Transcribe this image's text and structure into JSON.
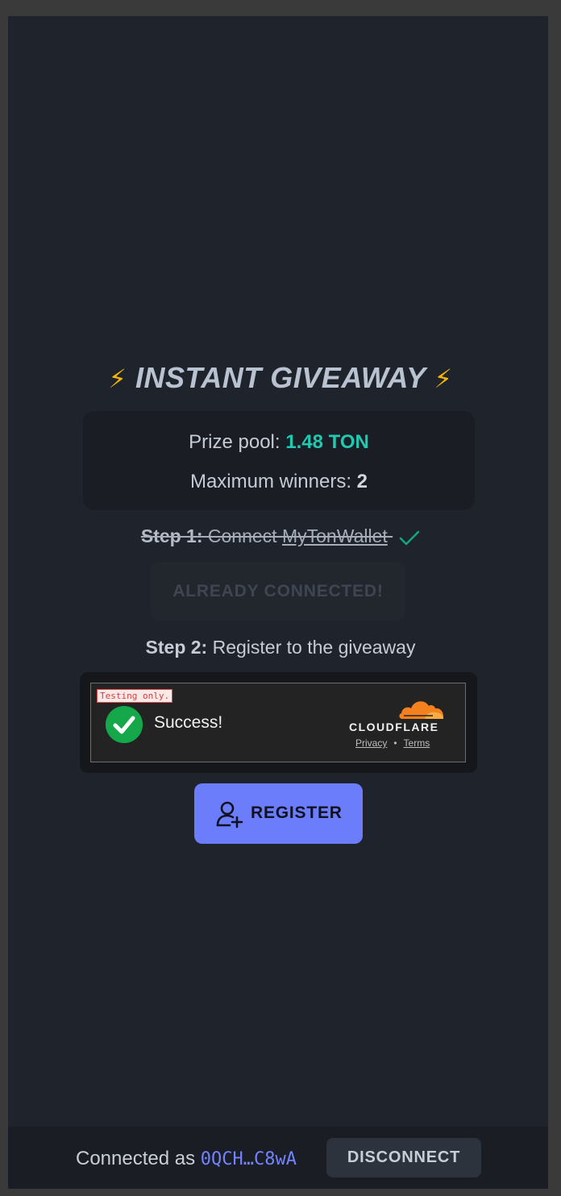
{
  "header": {
    "title": "INSTANT GIVEAWAY",
    "bolt_left": "⚡",
    "bolt_right": "⚡"
  },
  "prize": {
    "pool_label": "Prize pool: ",
    "pool_value": "1.48 TON",
    "winners_label": "Maximum winners: ",
    "winners_value": "2"
  },
  "step1": {
    "label": "Step 1:",
    "text": " Connect ",
    "wallet": "MyTonWallet",
    "button_label": "ALREADY CONNECTED!",
    "check_color": "#12a87a"
  },
  "step2": {
    "label": "Step 2:",
    "text": " Register to the giveaway"
  },
  "captcha": {
    "testing_label": "Testing only.",
    "status": "Success!",
    "brand": "CLOUDFLARE",
    "privacy": "Privacy",
    "separator": "•",
    "terms": "Terms"
  },
  "register": {
    "label": "REGISTER",
    "icon": "user-plus-icon"
  },
  "footer": {
    "connected_label": "Connected as ",
    "address": "0QCH…C8wA",
    "disconnect_label": "DISCONNECT"
  },
  "colors": {
    "accent": "#6c7dfc",
    "ton": "#1fc9b2",
    "background": "#1f242c"
  }
}
